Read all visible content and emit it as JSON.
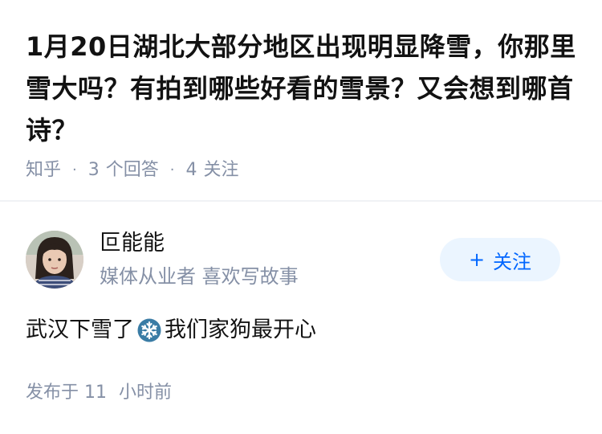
{
  "question": {
    "title": "1月20日湖北大部分地区出现明显降雪，你那里雪大吗？有拍到哪些好看的雪景？又会想到哪首诗？",
    "source": "知乎",
    "separator": "·",
    "answer_count": "3",
    "answer_label": "个回答",
    "follow_count": "4",
    "follow_label": "关注"
  },
  "answer": {
    "author": {
      "name": "叵能能",
      "bio": "媒体从业者 喜欢写故事",
      "avatar_icon": "user-photo"
    },
    "follow_button": {
      "plus": "+",
      "label": "关注"
    },
    "content_before": "武汉下雪了",
    "content_icon": "snowflake-icon",
    "content_after": "我们家狗最开心",
    "time_prefix": "发布于",
    "time_value": "11",
    "time_suffix": "小时前"
  },
  "colors": {
    "accent": "#0066ff",
    "follow_bg": "#ebf5ff",
    "meta_text": "#8590a6",
    "snow_bg": "#3a7ca5"
  }
}
